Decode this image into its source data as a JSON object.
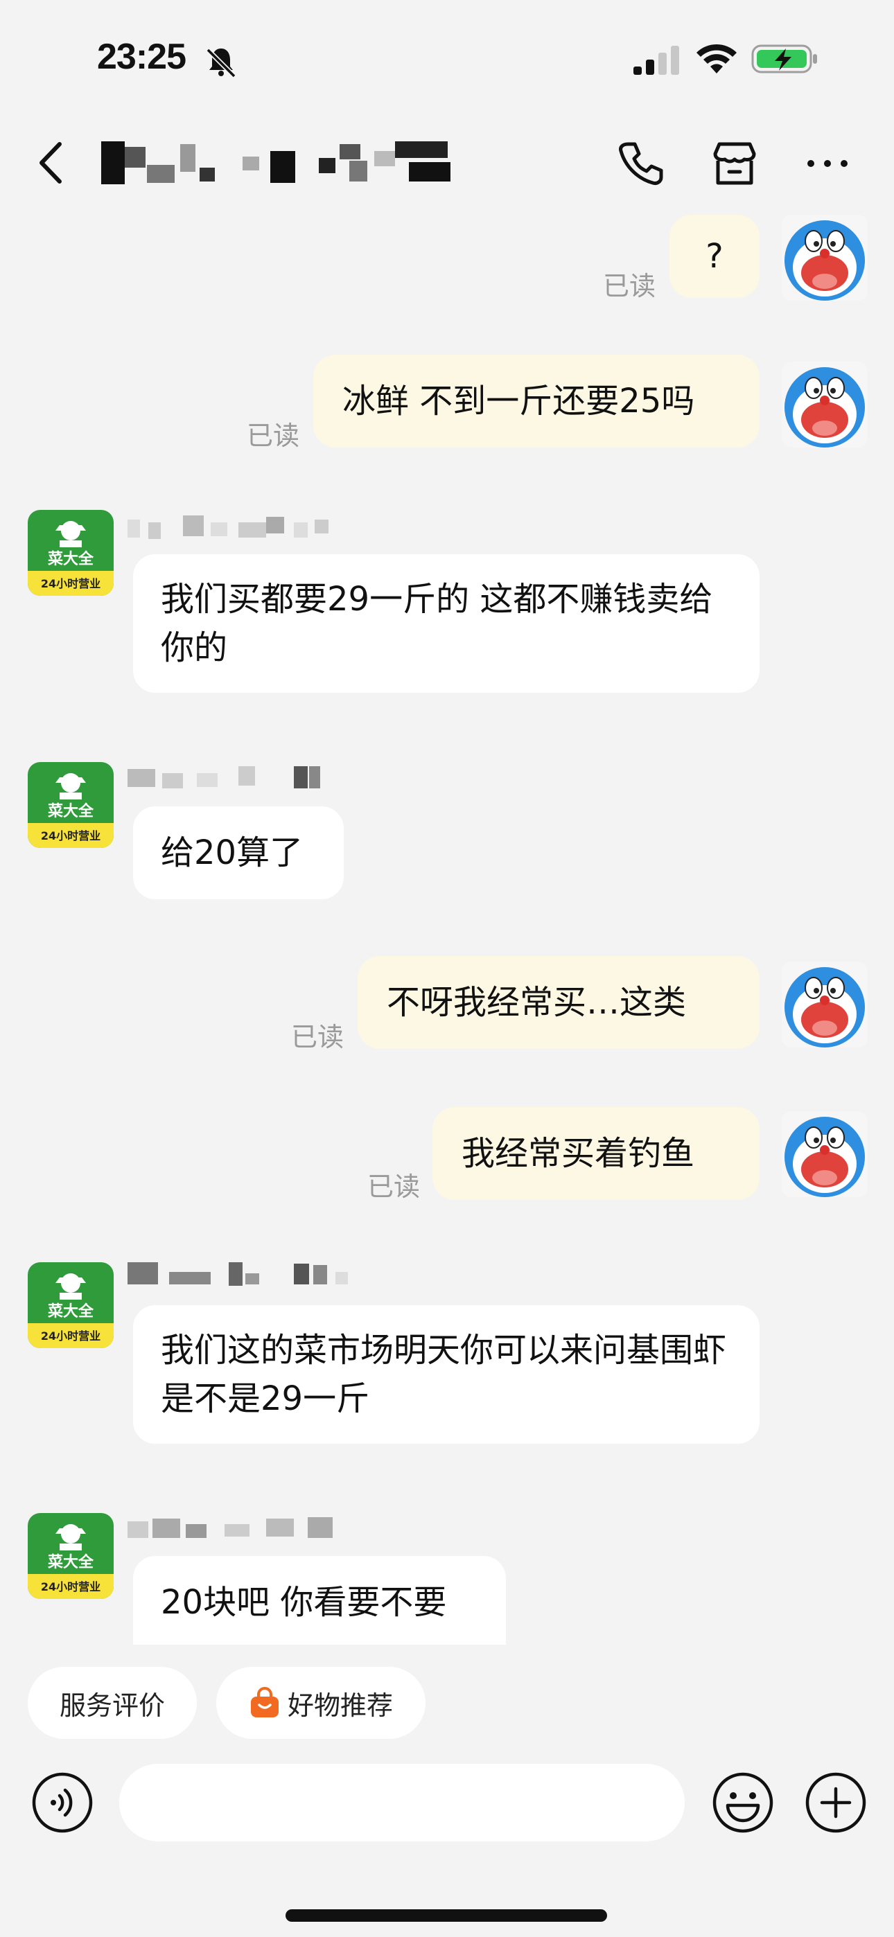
{
  "status_bar": {
    "time": "23:25"
  },
  "messages": [
    {
      "side": "out",
      "text": "?",
      "read": "已读"
    },
    {
      "side": "out",
      "text": "冰鲜 不到一斤还要25吗",
      "read": "已读"
    },
    {
      "side": "in",
      "text": "我们买都要29一斤的 这都不赚钱卖给你的"
    },
    {
      "side": "in",
      "text": "给20算了"
    },
    {
      "side": "out",
      "text": "不呀我经常买…这类",
      "read": "已读"
    },
    {
      "side": "out",
      "text": "我经常买着钓鱼",
      "read": "已读"
    },
    {
      "side": "in",
      "text": "我们这的菜市场明天你可以来问基围虾是不是29一斤"
    },
    {
      "side": "in",
      "text": "20块吧 你看要不要"
    }
  ],
  "store_avatar": {
    "name": "菜大全",
    "sub": "24小时营业"
  },
  "chips": [
    {
      "label": "服务评价"
    },
    {
      "label": "好物推荐",
      "icon": "shopping-bag-icon"
    }
  ],
  "colors": {
    "store_green": "#2f9b3a",
    "store_yellow": "#f7e23a",
    "bag_orange": "#f26a21"
  }
}
